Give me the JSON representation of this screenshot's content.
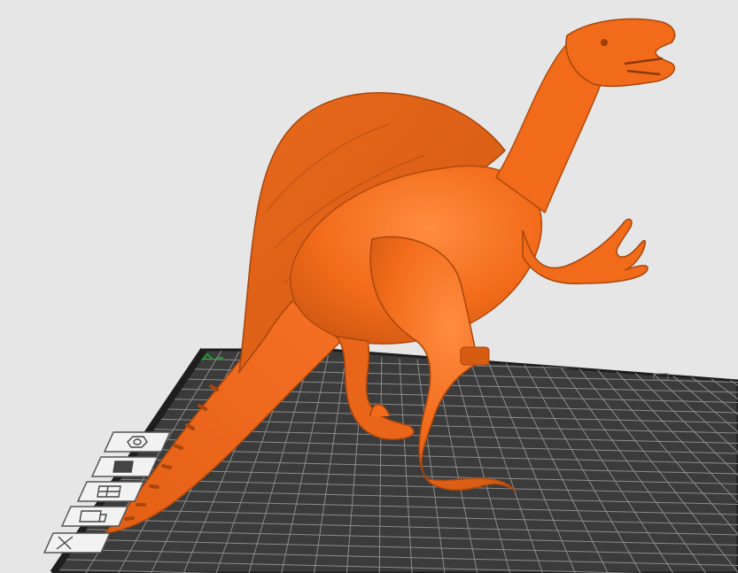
{
  "viewport": {
    "background": "#e6e6e6",
    "model": {
      "name": "spinosaurus-model",
      "color": "#f26b1a",
      "shadow_color": "#b44708",
      "highlight_color": "#ff8a3d"
    },
    "build_plate": {
      "color": "#3c3c3c",
      "grid_color": "#8c8c8c",
      "edge_color": "#1e1e1e",
      "axis_color": "#1a9e2e"
    }
  },
  "left_toolbar": {
    "buttons": [
      {
        "icon": "view-iso-icon"
      },
      {
        "icon": "view-front-icon"
      },
      {
        "icon": "view-top-icon"
      },
      {
        "icon": "view-side-icon"
      },
      {
        "icon": "close-view-icon"
      }
    ]
  }
}
